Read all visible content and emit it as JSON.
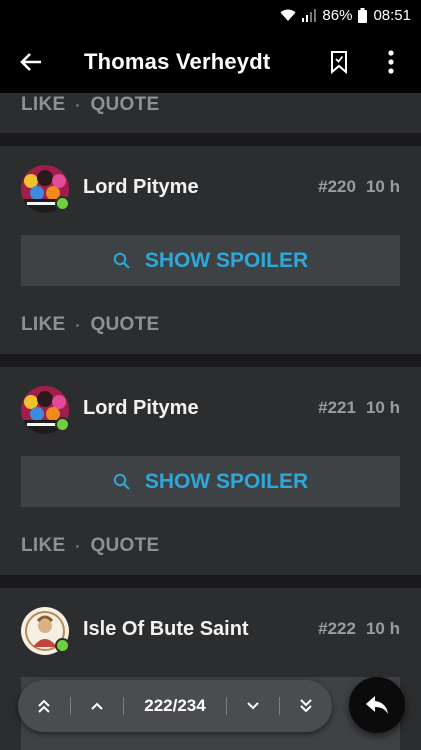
{
  "status_bar": {
    "battery": "86%",
    "time": "08:51"
  },
  "app_bar": {
    "title": "Thomas Verheydt",
    "back_icon": "back-arrow-icon",
    "bookmark_icon": "bookmark-icon",
    "menu_icon": "more-vert-icon"
  },
  "top_actions": {
    "like": "LIKE",
    "quote": "QUOTE",
    "sep": "·"
  },
  "posts": [
    {
      "author": "Lord Pityme",
      "number": "#220",
      "time": "10 h",
      "spoiler_label": "SHOW SPOILER",
      "like": "LIKE",
      "quote": "QUOTE",
      "sep": "·",
      "online": true
    },
    {
      "author": "Lord Pityme",
      "number": "#221",
      "time": "10 h",
      "spoiler_label": "SHOW SPOILER",
      "like": "LIKE",
      "quote": "QUOTE",
      "sep": "·",
      "online": true
    },
    {
      "author": "Isle Of Bute Saint",
      "number": "#222",
      "time": "10 h",
      "online": true
    }
  ],
  "pager": {
    "count": "222/234"
  },
  "colors": {
    "accent": "#2ea8d8",
    "card": "#2c2d2f",
    "online": "#6fcf3c"
  }
}
